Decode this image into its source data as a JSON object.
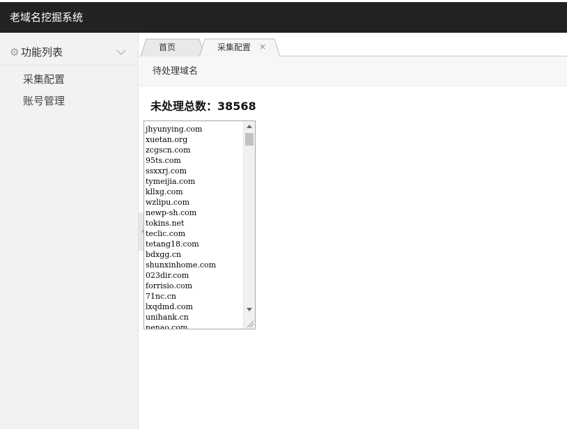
{
  "header": {
    "title": "老域名挖掘系统"
  },
  "sidebar": {
    "section_label": "功能列表",
    "section_icon": "gear-icon",
    "items": [
      {
        "label": "采集配置"
      },
      {
        "label": "账号管理"
      }
    ]
  },
  "tabs": [
    {
      "label": "首页",
      "closable": false
    },
    {
      "label": "采集配置",
      "closable": true,
      "close_glyph": "×"
    }
  ],
  "subnav": {
    "label": "待处理域名"
  },
  "main": {
    "count_heading": "未处理总数：38568",
    "domains": [
      "jhyunying.com",
      "xuetan.org",
      "zcgscn.com",
      "95ts.com",
      "ssxxrj.com",
      "tymeijia.com",
      "kllxg.com",
      "wzlipu.com",
      "newp-sh.com",
      "tokins.net",
      "teclic.com",
      "tetang18.com",
      "bdxgg.cn",
      "shunxinhome.com",
      "023dir.com",
      "forrisio.com",
      "71nc.cn",
      "lxqdmd.com",
      "unihank.cn",
      "nenao.com"
    ]
  },
  "colors": {
    "topbar": "#222222",
    "sidebar": "#f2f2f2",
    "subnav": "#f7f7f7"
  }
}
